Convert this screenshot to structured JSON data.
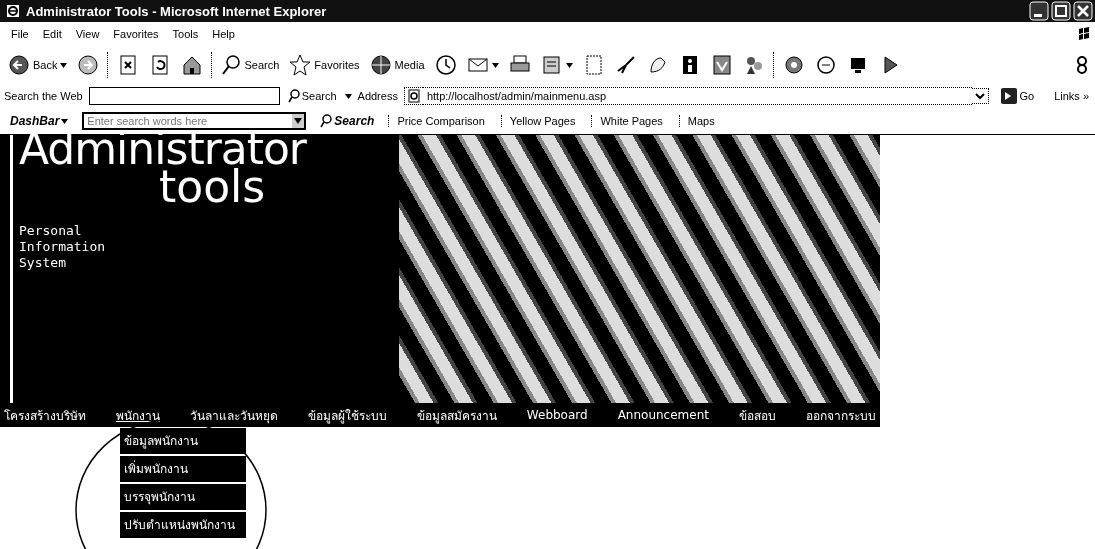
{
  "window": {
    "title": "Administrator Tools - Microsoft Internet Explorer"
  },
  "menu": [
    "File",
    "Edit",
    "View",
    "Favorites",
    "Tools",
    "Help"
  ],
  "toolbar": [
    {
      "kind": "button",
      "label": "Back",
      "dropdown": true
    },
    {
      "kind": "icon"
    },
    {
      "kind": "separator"
    },
    {
      "kind": "icon"
    },
    {
      "kind": "icon"
    },
    {
      "kind": "icon"
    },
    {
      "kind": "separator"
    },
    {
      "kind": "button",
      "label": "Search"
    },
    {
      "kind": "button",
      "label": "Favorites"
    },
    {
      "kind": "button",
      "label": "Media"
    },
    {
      "kind": "icon"
    },
    {
      "kind": "icon",
      "dropdown": true
    },
    {
      "kind": "icon"
    },
    {
      "kind": "icon",
      "dropdown": true
    },
    {
      "kind": "icon"
    },
    {
      "kind": "icon"
    },
    {
      "kind": "icon"
    },
    {
      "kind": "icon"
    },
    {
      "kind": "icon"
    },
    {
      "kind": "icon"
    },
    {
      "kind": "separator"
    },
    {
      "kind": "icon"
    },
    {
      "kind": "icon"
    },
    {
      "kind": "icon"
    },
    {
      "kind": "icon"
    }
  ],
  "search_bar": {
    "label": "Search the Web",
    "button": "Search",
    "address_label": "Address",
    "address": "http://localhost/admin/mainmenu.asp",
    "go": "Go",
    "links": "Links",
    "chevron": "»"
  },
  "dashbar": {
    "brand": "DashBar",
    "placeholder": "Enter search words here",
    "search": "Search",
    "links": [
      "Price Comparison",
      "Yellow Pages",
      "White Pages",
      "Maps"
    ]
  },
  "banner": {
    "title": "Administrator",
    "subtitle": "tools",
    "caption": [
      "Personal",
      "Information",
      "System"
    ]
  },
  "nav": [
    {
      "label": "โครงสร้างบริษัท",
      "expanded": false
    },
    {
      "label": "พนักงาน",
      "expanded": true,
      "children": [
        {
          "label": "ข้อมูลพนักงาน"
        },
        {
          "label": "เพิ่มพนักงาน"
        },
        {
          "label": "บรรจุพนักงาน"
        },
        {
          "label": "ปรับตำแหน่งพนักงาน"
        }
      ]
    },
    {
      "label": "วันลาและวันหยุด",
      "expanded": false
    },
    {
      "label": "ข้อมูลผู้ใช้ระบบ",
      "expanded": false
    },
    {
      "label": "ข้อมูลสมัครงาน",
      "expanded": false
    },
    {
      "label": "Webboard",
      "expanded": false
    },
    {
      "label": "Announcement",
      "expanded": false
    },
    {
      "label": "ข้อสอบ",
      "expanded": false
    },
    {
      "label": "ออกจากระบบ",
      "expanded": false
    }
  ]
}
